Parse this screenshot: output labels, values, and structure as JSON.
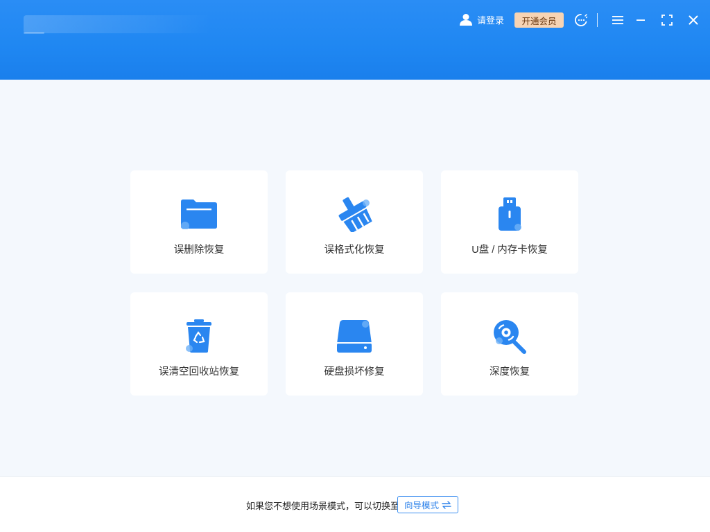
{
  "header": {
    "login_label": "请登录",
    "vip_label": "开通会员"
  },
  "cards": [
    {
      "label": "误删除恢复",
      "icon": "folder-icon"
    },
    {
      "label": "误格式化恢复",
      "icon": "broom-icon"
    },
    {
      "label": "U盘 / 内存卡恢复",
      "icon": "usb-drive-icon"
    },
    {
      "label": "误清空回收站恢复",
      "icon": "recycle-bin-icon"
    },
    {
      "label": "硬盘损坏修复",
      "icon": "hard-disk-icon"
    },
    {
      "label": "深度恢复",
      "icon": "deep-scan-icon"
    }
  ],
  "footer": {
    "tip": "如果您不想使用场景模式，可以切换至",
    "guide_label": "向导模式"
  },
  "colors": {
    "header_blue": "#1f87f2",
    "icon_blue": "#2a86f0",
    "vip_bg": "#f7d4b4"
  }
}
